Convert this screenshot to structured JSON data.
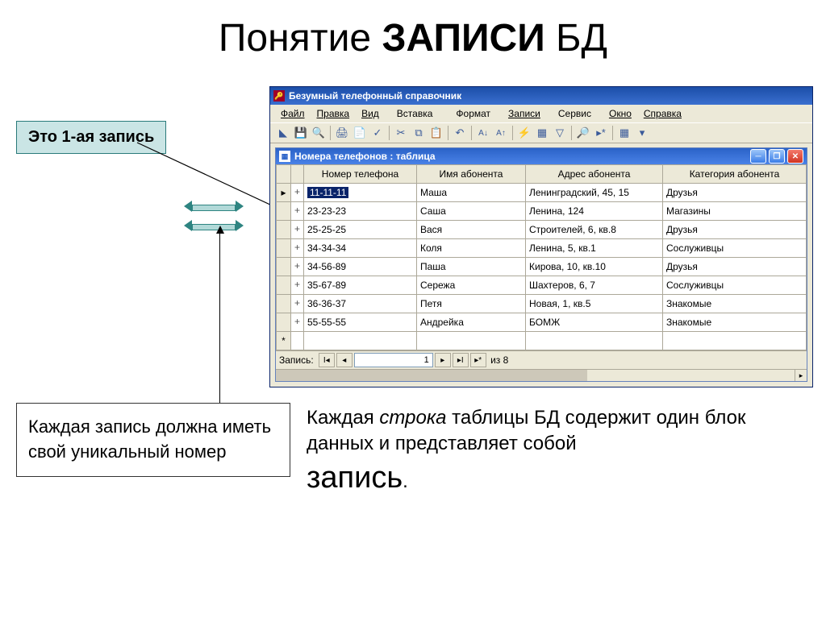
{
  "title": {
    "prefix": "Понятие ",
    "bold": "ЗАПИСИ",
    "suffix": " БД"
  },
  "annot1": "Это 1-ая запись",
  "annot2": "Каждая запись должна иметь свой уникальный номер",
  "desc": {
    "t1": "Каждая ",
    "em": "строка",
    "t2": " таблицы БД содержит один блок данных и представляет собой ",
    "big": "запись",
    "t3": "."
  },
  "app": {
    "title": "Безумный телефонный справочник",
    "menu": [
      "Файл",
      "Правка",
      "Вид",
      "Вставка",
      "Формат",
      "Записи",
      "Сервис",
      "Окно",
      "Справка"
    ],
    "table_title": "Номера телефонов : таблица",
    "columns": [
      "Номер телефона",
      "Имя абонента",
      "Адрес абонента",
      "Категория абонента"
    ],
    "rows": [
      {
        "sel": true,
        "phone": "11-11-11",
        "name": "Маша",
        "addr": "Ленинградский, 45, 15",
        "cat": "Друзья"
      },
      {
        "sel": false,
        "phone": "23-23-23",
        "name": "Саша",
        "addr": "Ленина, 124",
        "cat": "Магазины"
      },
      {
        "sel": false,
        "phone": "25-25-25",
        "name": "Вася",
        "addr": "Строителей, 6, кв.8",
        "cat": "Друзья"
      },
      {
        "sel": false,
        "phone": "34-34-34",
        "name": "Коля",
        "addr": "Ленина, 5, кв.1",
        "cat": "Сослуживцы"
      },
      {
        "sel": false,
        "phone": "34-56-89",
        "name": "Паша",
        "addr": "Кирова, 10, кв.10",
        "cat": "Друзья"
      },
      {
        "sel": false,
        "phone": "35-67-89",
        "name": "Сережа",
        "addr": "Шахтеров, 6, 7",
        "cat": "Сослуживцы"
      },
      {
        "sel": false,
        "phone": "36-36-37",
        "name": "Петя",
        "addr": "Новая, 1, кв.5",
        "cat": "Знакомые"
      },
      {
        "sel": false,
        "phone": "55-55-55",
        "name": "Андрейка",
        "addr": "БОМЖ",
        "cat": "Знакомые"
      }
    ],
    "recnav": {
      "label": "Запись:",
      "value": "1",
      "of_label": "из",
      "total": "8"
    }
  }
}
